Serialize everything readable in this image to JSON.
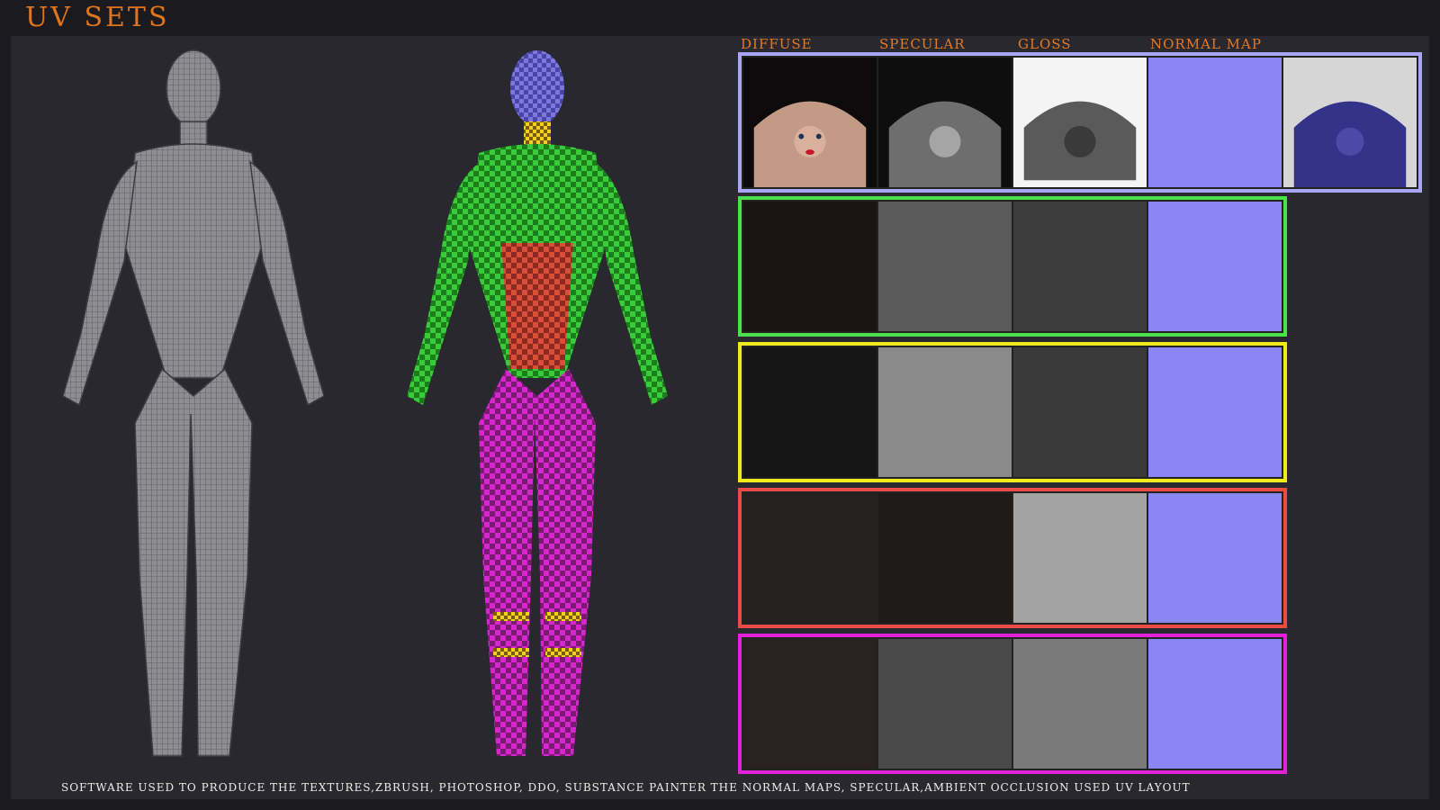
{
  "title": "UV SETS",
  "columns": [
    "DIFFUSE",
    "SPECULAR",
    "GLOSS",
    "NORMAL MAP"
  ],
  "footer": "SOFTWARE USED TO PRODUCE THE TEXTURES,ZBRUSH, PHOTOSHOP, DDO, SUBSTANCE PAINTER THE NORMAL MAPS, SPECULAR,AMBIENT OCCLUSION USED UV LAYOUT",
  "colors": {
    "title": "#e0751f",
    "set_head": "#a9a6f4",
    "set_torso": "#4de04c",
    "set_legs": "#f1ea1f",
    "set_details": "#ec4a44",
    "set_boots": "#e321d8",
    "normal": "#8a86f5"
  },
  "uv_sets": [
    {
      "id": "head",
      "color": "#a9a6f4",
      "tiles": [
        "diffuse",
        "specular",
        "gloss",
        "normal-map",
        "ambient-occlusion"
      ]
    },
    {
      "id": "torso",
      "color": "#4de04c",
      "tiles": [
        "diffuse",
        "specular",
        "gloss",
        "normal-map"
      ]
    },
    {
      "id": "legs",
      "color": "#f1ea1f",
      "tiles": [
        "diffuse",
        "specular",
        "gloss",
        "normal-map"
      ]
    },
    {
      "id": "details",
      "color": "#ec4a44",
      "tiles": [
        "diffuse",
        "specular",
        "gloss",
        "normal-map"
      ]
    },
    {
      "id": "boots",
      "color": "#e321d8",
      "tiles": [
        "diffuse",
        "specular",
        "gloss",
        "normal-map"
      ]
    }
  ]
}
